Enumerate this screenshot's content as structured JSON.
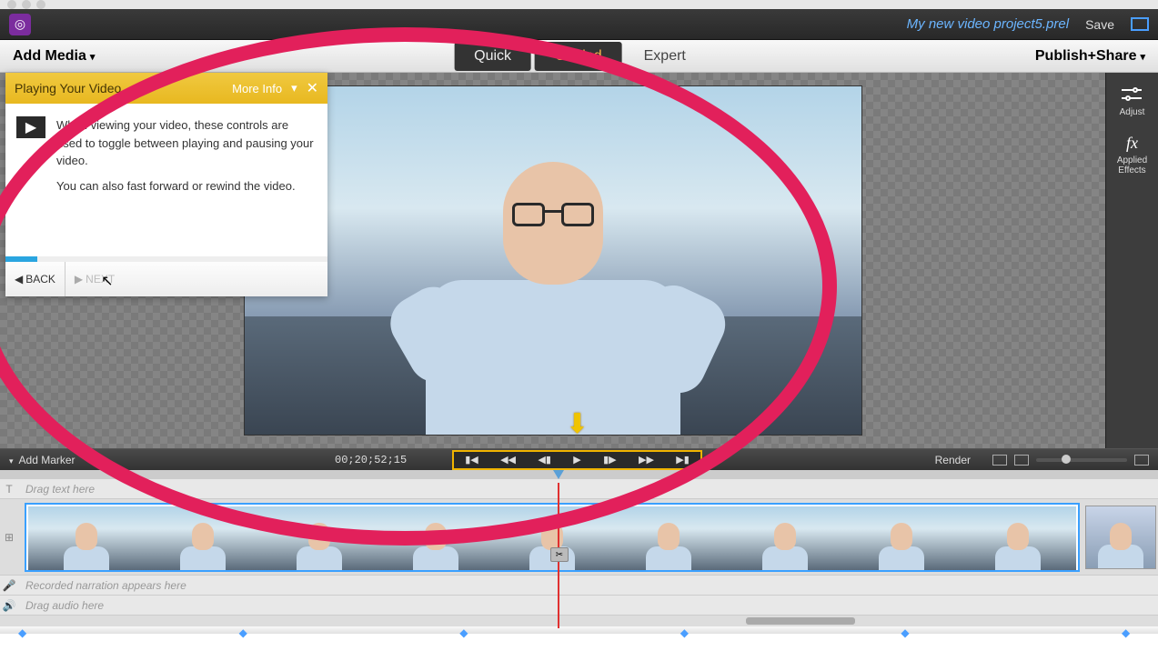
{
  "topbar": {
    "project_name": "My new video project5.prel",
    "save": "Save"
  },
  "menubar": {
    "add_media": "Add Media",
    "modes": {
      "quick": "Quick",
      "guided": "Guided",
      "expert": "Expert"
    },
    "publish": "Publish+Share"
  },
  "right_panel": {
    "adjust": "Adjust",
    "effects_icon": "fx",
    "effects": "Applied Effects"
  },
  "tutorial": {
    "title": "Playing Your Video",
    "more_info": "More Info",
    "body1": "When viewing your video, these controls are used to toggle between playing and pausing your video.",
    "body2": "You can also fast forward or rewind the video.",
    "back": "BACK",
    "next": "NEXT"
  },
  "controls": {
    "add_marker": "Add Marker",
    "timecode": "00;20;52;15",
    "render": "Render"
  },
  "timeline": {
    "text_hint": "Drag text here",
    "narration_hint": "Recorded narration appears here",
    "audio_hint": "Drag audio here"
  }
}
